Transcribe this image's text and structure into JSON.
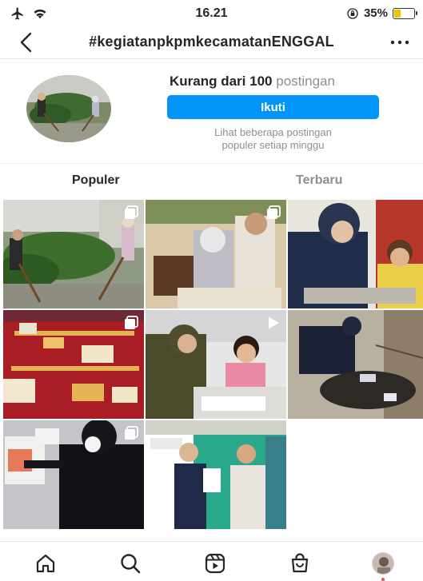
{
  "status_bar": {
    "time": "16.21",
    "battery_percent": "35%",
    "battery_level": 0.35,
    "icons": [
      "airplane-mode-icon",
      "wifi-icon",
      "orientation-lock-icon",
      "battery-icon"
    ]
  },
  "header": {
    "title": "#kegiatanpkpmkecamatanENGGAL",
    "back_icon": "chevron-left-icon",
    "more_icon": "more-horizontal-icon"
  },
  "hashtag_info": {
    "post_count_bold": "Kurang dari 100",
    "post_count_unit": "postingan",
    "follow_label": "Ikuti",
    "note_line1": "Lihat beberapa postingan",
    "note_line2": "populer setiap minggu"
  },
  "tabs": {
    "popular": "Populer",
    "recent": "Terbaru",
    "active": "Populer"
  },
  "colors": {
    "accent": "#0095f6",
    "text": "#262626",
    "muted": "#8e8e8e",
    "notification_dot": "#ed4956",
    "battery_yellow": "#f2c200"
  },
  "grid": [
    {
      "badge": "carousel-icon"
    },
    {
      "badge": "carousel-icon"
    },
    {
      "badge": ""
    },
    {
      "badge": "carousel-icon"
    },
    {
      "badge": "video-play-icon"
    },
    {
      "badge": ""
    },
    {
      "badge": "carousel-icon"
    },
    {
      "badge": ""
    }
  ],
  "bottom_nav": {
    "items": [
      "home-icon",
      "search-icon",
      "reels-icon",
      "shop-icon",
      "profile-avatar"
    ]
  }
}
